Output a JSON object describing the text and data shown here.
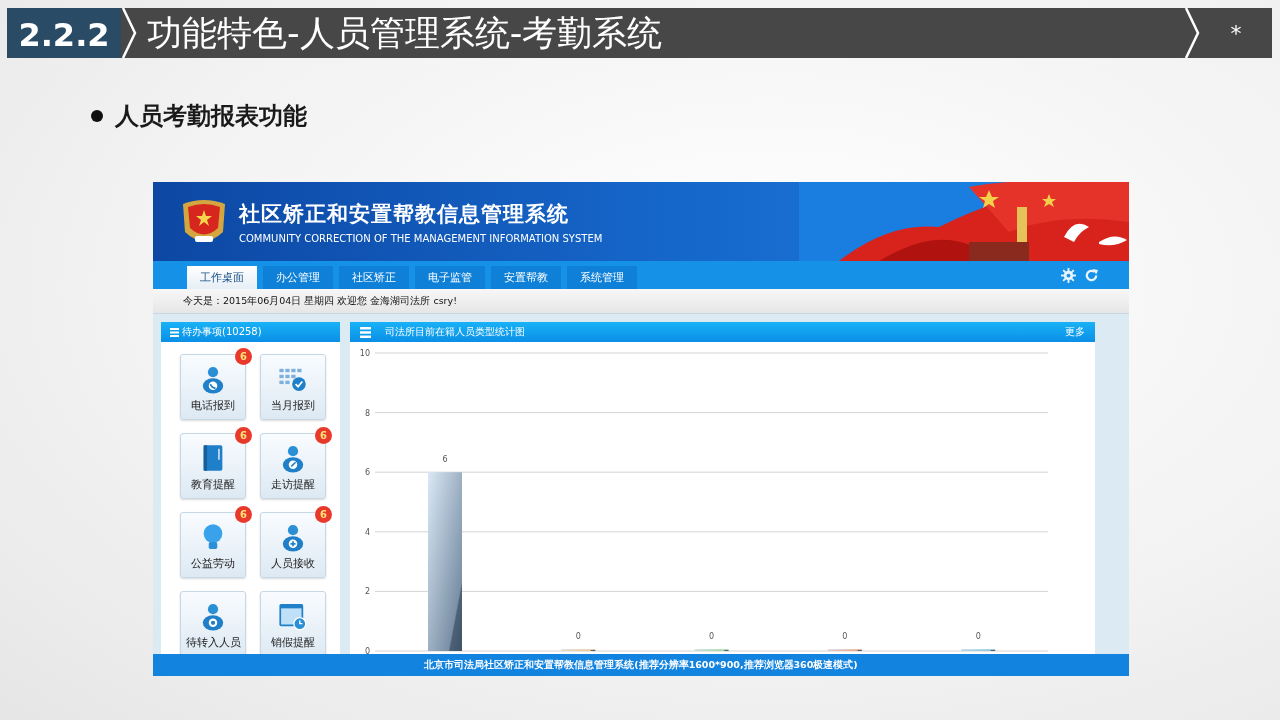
{
  "slide": {
    "section": "2.2.2",
    "title": "功能特色-人员管理系统-考勤系统",
    "corner_mark": "*",
    "bullet": "人员考勤报表功能"
  },
  "app": {
    "title": "社区矫正和安置帮教信息管理系统",
    "subtitle": "COMMUNITY CORRECTION OF THE MANAGEMENT INFORMATION SYSTEM",
    "tabs": [
      {
        "label": "工作桌面",
        "selected": true
      },
      {
        "label": "办公管理",
        "selected": false
      },
      {
        "label": "社区矫正",
        "selected": false
      },
      {
        "label": "电子监管",
        "selected": false
      },
      {
        "label": "安置帮教",
        "selected": false
      },
      {
        "label": "系统管理",
        "selected": false
      }
    ],
    "info_bar": "今天是：2015年06月04日 星期四 欢迎您 金海湖司法所 csry!",
    "todo_panel": {
      "title": "待办事项(10258)",
      "tiles": [
        {
          "label": "电话报到",
          "badge": "6"
        },
        {
          "label": "当月报到"
        },
        {
          "label": "教育提醒",
          "badge": "6"
        },
        {
          "label": "走访提醒",
          "badge": "6"
        },
        {
          "label": "公益劳动",
          "badge": "6"
        },
        {
          "label": "人员接收",
          "badge": "6"
        },
        {
          "label": "待转入人员"
        },
        {
          "label": "销假提醒"
        }
      ]
    },
    "chart_panel": {
      "title": "司法所目前在籍人员类型统计图",
      "more": "更多",
      "chart_data": {
        "type": "bar",
        "values": [
          6,
          0,
          0,
          0,
          0
        ],
        "ylim": [
          0,
          10
        ],
        "yticks": [
          0,
          2,
          4,
          6,
          8,
          10
        ],
        "data_labels": true,
        "grid": true
      }
    },
    "footer": "北京市司法局社区矫正和安置帮教信息管理系统(推荐分辨率1600*900,推荐浏览器360极速模式)"
  }
}
